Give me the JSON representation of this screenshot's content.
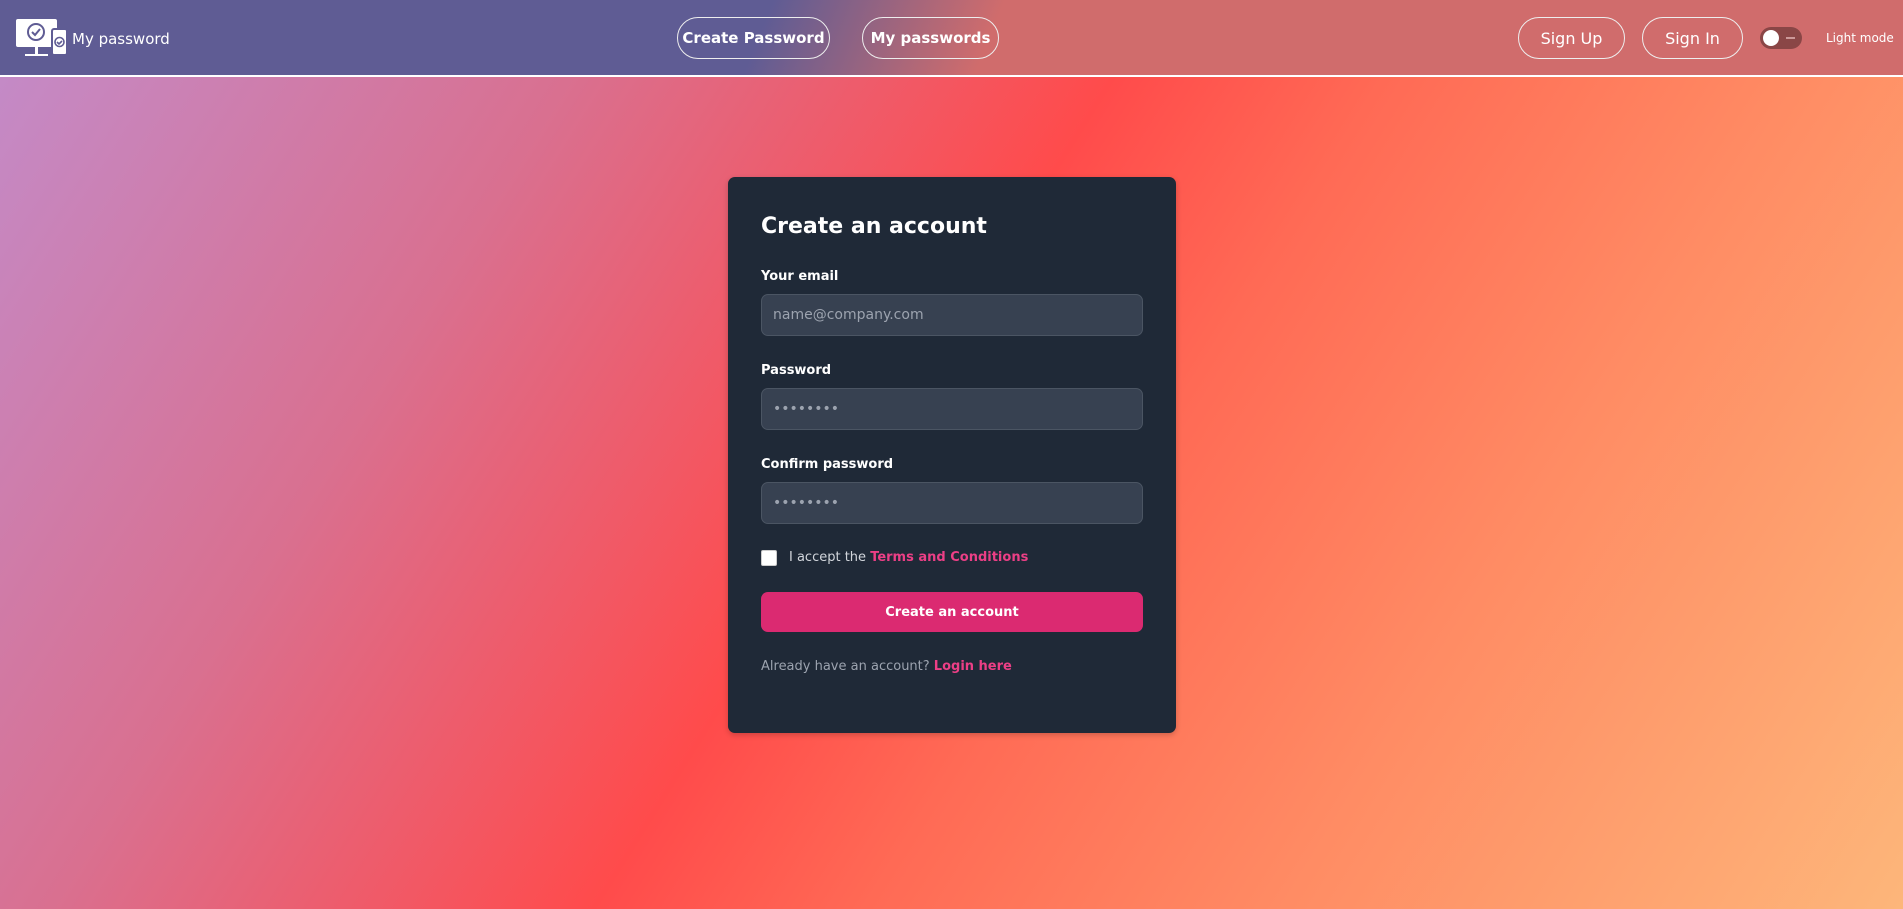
{
  "nav": {
    "brand": "My password",
    "create_password": "Create Password",
    "my_passwords": "My passwords",
    "sign_up": "Sign Up",
    "sign_in": "Sign In",
    "theme_toggle_on": false,
    "theme_label": "Light mode"
  },
  "form": {
    "title": "Create an account",
    "email_label": "Your email",
    "email_placeholder": "name@company.com",
    "password_label": "Password",
    "password_value": "••••••••",
    "confirm_label": "Confirm password",
    "confirm_value": "••••••••",
    "terms_prefix": "I accept the ",
    "terms_link": "Terms and Conditions",
    "terms_checked": false,
    "submit": "Create an account",
    "login_prompt": "Already have an account? ",
    "login_link": "Login here"
  },
  "colors": {
    "accent": "#db2a71",
    "link": "#ec3f86",
    "card": "#1f2937",
    "nav_left": "#5f5c94",
    "nav_right": "#d06c6c"
  }
}
